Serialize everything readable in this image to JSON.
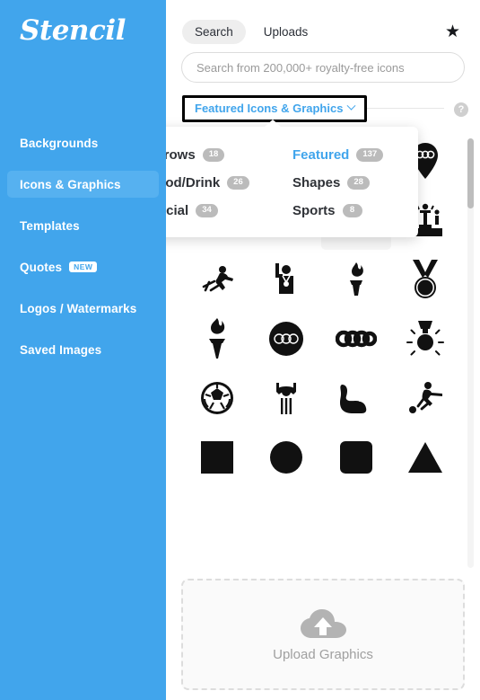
{
  "sidebar": {
    "logo": "Stencil",
    "items": [
      {
        "label": "Backgrounds",
        "active": false,
        "badge": ""
      },
      {
        "label": "Icons & Graphics",
        "active": true,
        "badge": ""
      },
      {
        "label": "Templates",
        "active": false,
        "badge": ""
      },
      {
        "label": "Quotes",
        "active": false,
        "badge": "NEW"
      },
      {
        "label": "Logos / Watermarks",
        "active": false,
        "badge": ""
      },
      {
        "label": "Saved Images",
        "active": false,
        "badge": ""
      }
    ],
    "bg_color": "#41a5ec",
    "active_color": "#56b1f0"
  },
  "tabs": [
    {
      "label": "Search",
      "active": true
    },
    {
      "label": "Uploads",
      "active": false
    }
  ],
  "favorites_icon": "star-icon",
  "favorites_glyph": "★",
  "search": {
    "placeholder": "Search from 200,000+ royalty-free icons",
    "value": ""
  },
  "category_selector": {
    "label": "Featured Icons & Graphics",
    "chevron": "chevron-down-icon",
    "focused": true
  },
  "help": {
    "glyph": "?",
    "name": "help-icon"
  },
  "dropdown": {
    "open": true,
    "items": [
      {
        "label": "Arrows",
        "count": "18",
        "selected": false,
        "col": 1
      },
      {
        "label": "Featured",
        "count": "137",
        "selected": true,
        "col": 2
      },
      {
        "label": "Food/Drink",
        "count": "26",
        "selected": false,
        "col": 1
      },
      {
        "label": "Shapes",
        "count": "28",
        "selected": false,
        "col": 2
      },
      {
        "label": "Social",
        "count": "34",
        "selected": false,
        "col": 1
      },
      {
        "label": "Sports",
        "count": "8",
        "selected": false,
        "col": 2
      }
    ]
  },
  "icon_grid": {
    "columns": 4,
    "icons": [
      {
        "name": "map-pin-olympic-rings-icon",
        "row": 1,
        "col": 1,
        "hover": false
      },
      {
        "name": "map-pin-olympic-rings-icon",
        "row": 1,
        "col": 2,
        "hover": false
      },
      {
        "name": "olympic-rings-outline-icon",
        "row": 1,
        "col": 3,
        "hover": true
      },
      {
        "name": "map-pin-olympic-rings-icon",
        "row": 1,
        "col": 4,
        "hover": false
      },
      {
        "name": "medal-award-icon",
        "row": 2,
        "col": 1,
        "hover": false
      },
      {
        "name": "trophy-cup-icon",
        "row": 2,
        "col": 2,
        "hover": false
      },
      {
        "name": "olympic-rings-thin-icon",
        "row": 2,
        "col": 3,
        "hover": true
      },
      {
        "name": "winners-podium-icon",
        "row": 2,
        "col": 4,
        "hover": false
      },
      {
        "name": "runner-sprinting-icon",
        "row": 3,
        "col": 1,
        "hover": false
      },
      {
        "name": "athlete-with-medal-icon",
        "row": 3,
        "col": 2,
        "hover": false
      },
      {
        "name": "olympic-torch-small-icon",
        "row": 3,
        "col": 3,
        "hover": false
      },
      {
        "name": "medal-ribbon-icon",
        "row": 3,
        "col": 4,
        "hover": false
      },
      {
        "name": "olympic-torch-icon",
        "row": 4,
        "col": 1,
        "hover": false
      },
      {
        "name": "olympic-rings-circle-icon",
        "row": 4,
        "col": 2,
        "hover": false
      },
      {
        "name": "olympic-rings-bold-icon",
        "row": 4,
        "col": 3,
        "hover": false
      },
      {
        "name": "medal-shine-icon",
        "row": 4,
        "col": 4,
        "hover": false
      },
      {
        "name": "soccer-ball-icon",
        "row": 5,
        "col": 1,
        "hover": false
      },
      {
        "name": "referee-signal-icon",
        "row": 5,
        "col": 2,
        "hover": false
      },
      {
        "name": "flexed-bicep-icon",
        "row": 5,
        "col": 3,
        "hover": false
      },
      {
        "name": "soccer-player-icon",
        "row": 5,
        "col": 4,
        "hover": false
      },
      {
        "name": "square-shape-icon",
        "row": 6,
        "col": 1,
        "hover": false
      },
      {
        "name": "circle-shape-icon",
        "row": 6,
        "col": 2,
        "hover": false
      },
      {
        "name": "rounded-square-shape-icon",
        "row": 6,
        "col": 3,
        "hover": false
      },
      {
        "name": "triangle-shape-icon",
        "row": 6,
        "col": 4,
        "hover": false
      }
    ]
  },
  "upload": {
    "label": "Upload Graphics",
    "icon": "cloud-upload-icon"
  },
  "scrollbar": {
    "thumb_position_pct": 0,
    "thumb_size_pct": 16
  }
}
